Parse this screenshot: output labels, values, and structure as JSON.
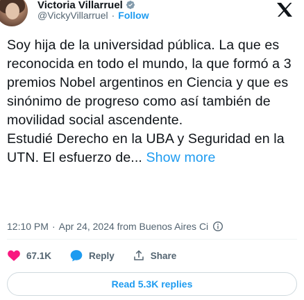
{
  "author": {
    "display_name": "Victoria Villarruel",
    "handle": "@VickyVillarruel",
    "follow_label": "Follow",
    "separator": "·"
  },
  "tweet": {
    "text": "Soy hija de la universidad pública. La que es reconocida en todo el mundo, la que formó a 3 premios Nobel argentinos en Ciencia y que es sinónimo de progreso como así también de movilidad social ascendente.\nEstudié Derecho en la UBA y Seguridad en la UTN. El esfuerzo de...",
    "show_more": "Show more",
    "time": "12:10 PM",
    "date_location": "Apr 24, 2024 from Buenos Aires Ci",
    "separator": "·"
  },
  "actions": {
    "likes": "67.1K",
    "reply_label": "Reply",
    "share_label": "Share"
  },
  "read_replies_label": "Read 5.3K replies",
  "colors": {
    "accent": "#1d9bf0",
    "like_red": "#f91880",
    "muted": "#536471",
    "text": "#0f1419"
  },
  "icons": [
    "verified-badge-icon",
    "x-logo-icon",
    "info-icon",
    "heart-icon",
    "reply-icon",
    "share-icon"
  ]
}
